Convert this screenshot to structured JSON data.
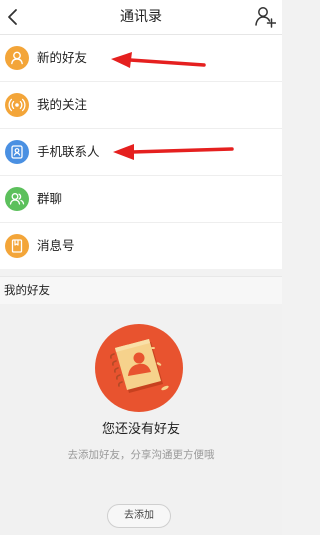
{
  "header": {
    "title": "通讯录",
    "back_icon": "chevron-left-icon",
    "add_icon": "add-friend-icon"
  },
  "menu": {
    "items": [
      {
        "label": "新的好友",
        "icon": "person-icon",
        "color": "#f3a539"
      },
      {
        "label": "我的关注",
        "icon": "broadcast-icon",
        "color": "#f3a539"
      },
      {
        "label": "手机联系人",
        "icon": "contact-card-icon",
        "color": "#4a90e2"
      },
      {
        "label": "群聊",
        "icon": "group-icon",
        "color": "#5cc05c"
      },
      {
        "label": "消息号",
        "icon": "bookmark-icon",
        "color": "#f3a539"
      }
    ]
  },
  "section": {
    "label": "我的好友"
  },
  "empty": {
    "title": "您还没有好友",
    "subtitle": "去添加好友，分享沟通更方便哦",
    "button_label": "去添加"
  },
  "colors": {
    "annotation_arrow": "#e5201f",
    "badge": "#e8532f"
  }
}
